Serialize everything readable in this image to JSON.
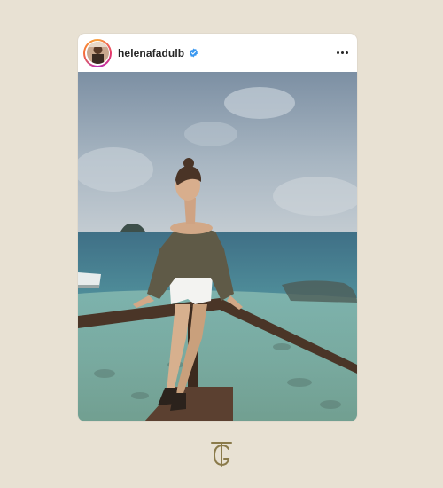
{
  "post": {
    "username": "helenafadulb",
    "verified": true,
    "more_icon": "more-horizontal-icon"
  },
  "brand": {
    "logo_text": "TG",
    "logo_color": "#8a7a4a"
  },
  "colors": {
    "background": "#e8e1d3",
    "card": "#ffffff",
    "verified_blue": "#3897f0"
  }
}
